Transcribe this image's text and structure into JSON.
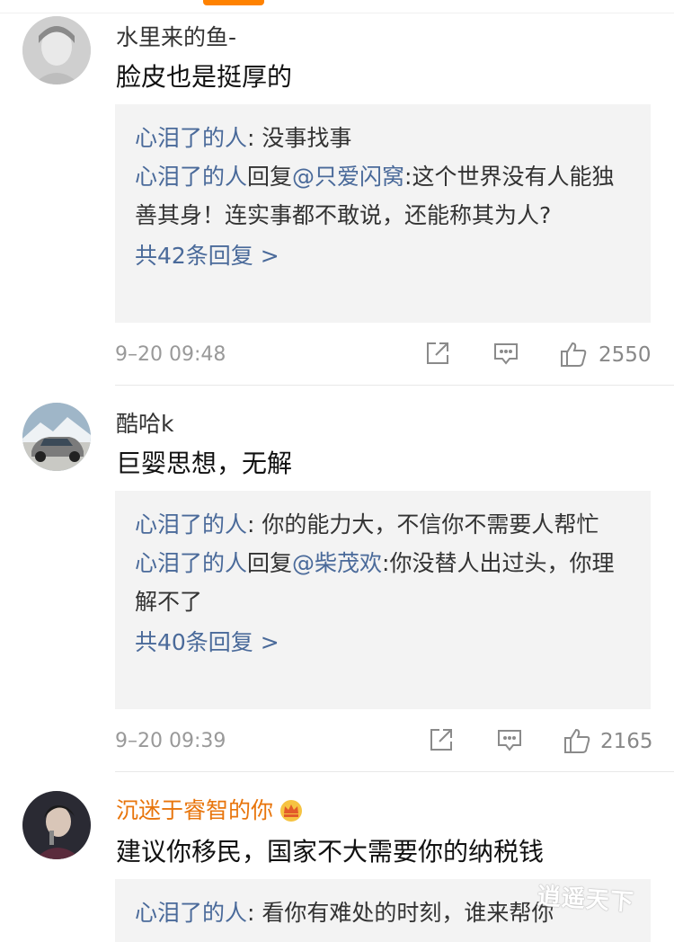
{
  "comments": [
    {
      "username": "水里来的鱼-",
      "text": "脸皮也是挺厚的",
      "replies": [
        {
          "user": "心泪了的人",
          "sep": ": ",
          "content": "没事找事"
        },
        {
          "user": "心泪了的人",
          "mid": "回复",
          "mention": "@只爱闪窝",
          "sep": ":",
          "content": "这个世界没有人能独善其身！连实事都不敢说，还能称其为人?"
        }
      ],
      "more_replies": "共42条回复 >",
      "time": "9–20 09:48",
      "likes": "2550"
    },
    {
      "username": "酷哈k",
      "text": "巨婴思想，无解",
      "replies": [
        {
          "user": "心泪了的人",
          "sep": ": ",
          "content": "你的能力大，不信你不需要人帮忙"
        },
        {
          "user": "心泪了的人",
          "mid": "回复",
          "mention": "@柴茂欢",
          "sep": ":",
          "content": "你没替人出过头，你理解不了"
        }
      ],
      "more_replies": "共40条回复 >",
      "time": "9–20 09:39",
      "likes": "2165"
    },
    {
      "username": "沉迷于睿智的你",
      "text": "建议你移民，国家不大需要你的纳税钱",
      "replies": [
        {
          "user": "心泪了的人",
          "sep": ": ",
          "content": "看你有难处的时刻，谁来帮你"
        }
      ]
    }
  ],
  "watermark": "逍遥天下",
  "colors": {
    "accent": "#ff8200",
    "username_link": "#4a6a9a",
    "vip_name": "#e8750c",
    "reply_bg": "#f3f3f3"
  },
  "icons": [
    "share-icon",
    "comment-icon",
    "like-icon",
    "crown-icon"
  ]
}
